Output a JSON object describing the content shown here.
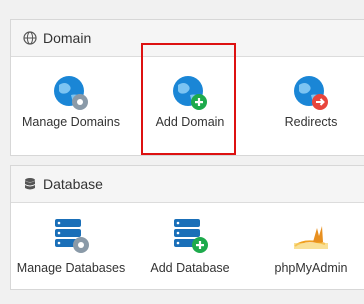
{
  "domain_section": {
    "title": "Domain",
    "items": [
      {
        "label": "Manage Domains",
        "icon": "globe-gear-icon"
      },
      {
        "label": "Add Domain",
        "icon": "globe-plus-icon"
      },
      {
        "label": "Redirects",
        "icon": "globe-redirect-icon"
      }
    ]
  },
  "database_section": {
    "title": "Database",
    "items": [
      {
        "label": "Manage Databases",
        "icon": "database-gear-icon"
      },
      {
        "label": "Add Database",
        "icon": "database-plus-icon"
      },
      {
        "label": "phpMyAdmin",
        "icon": "phpmyadmin-logo-icon"
      }
    ]
  },
  "colors": {
    "globe_blue": "#1a86d6",
    "gear_gray": "#8a9aa8",
    "add_green": "#1eaa4c",
    "redirect_red": "#e8453c",
    "highlight_red": "#dd1111"
  }
}
